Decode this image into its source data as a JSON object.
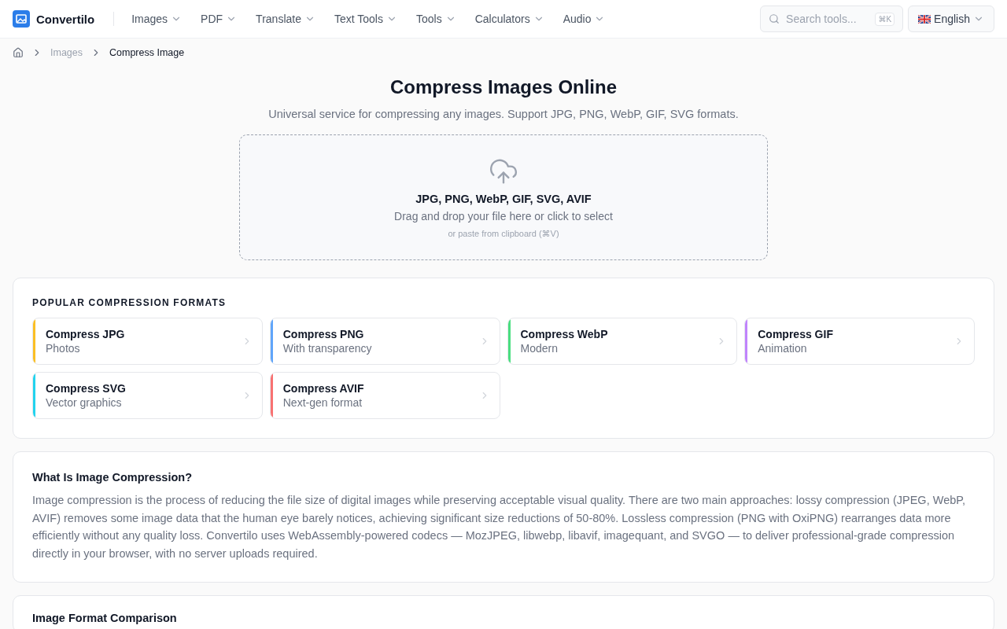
{
  "header": {
    "logo": "Convertilo",
    "nav": [
      "Images",
      "PDF",
      "Translate",
      "Text Tools",
      "Tools",
      "Calculators",
      "Audio"
    ],
    "search": {
      "placeholder": "Search tools...",
      "shortcut": "⌘K"
    },
    "language": "English"
  },
  "breadcrumb": [
    "Images",
    "Compress Image"
  ],
  "hero": {
    "title": "Compress Images Online",
    "subtitle": "Universal service for compressing any images. Support JPG, PNG, WebP, GIF, SVG formats."
  },
  "dropzone": {
    "formats": "JPG, PNG, WebP, GIF, SVG, AVIF",
    "hint": "Drag and drop your file here or click to select",
    "paste": "or paste from clipboard (⌘V)"
  },
  "popular": {
    "heading": "POPULAR COMPRESSION FORMATS",
    "items": [
      {
        "title": "Compress JPG",
        "subtitle": "Photos",
        "color": "#fbbf24"
      },
      {
        "title": "Compress PNG",
        "subtitle": "With transparency",
        "color": "#60a5fa"
      },
      {
        "title": "Compress WebP",
        "subtitle": "Modern",
        "color": "#4ade80"
      },
      {
        "title": "Compress GIF",
        "subtitle": "Animation",
        "color": "#c084fc"
      },
      {
        "title": "Compress SVG",
        "subtitle": "Vector graphics",
        "color": "#22d3ee"
      },
      {
        "title": "Compress AVIF",
        "subtitle": "Next-gen format",
        "color": "#f87171"
      }
    ]
  },
  "sections": [
    {
      "title": "What Is Image Compression?",
      "body": "Image compression is the process of reducing the file size of digital images while preserving acceptable visual quality. There are two main approaches: lossy compression (JPEG, WebP, AVIF) removes some image data that the human eye barely notices, achieving significant size reductions of 50-80%. Lossless compression (PNG with OxiPNG) rearranges data more efficiently without any quality loss. Convertilo uses WebAssembly-powered codecs — MozJPEG, libwebp, libavif, imagequant, and SVGO — to deliver professional-grade compression directly in your browser, with no server uploads required."
    },
    {
      "title": "Image Format Comparison"
    }
  ]
}
